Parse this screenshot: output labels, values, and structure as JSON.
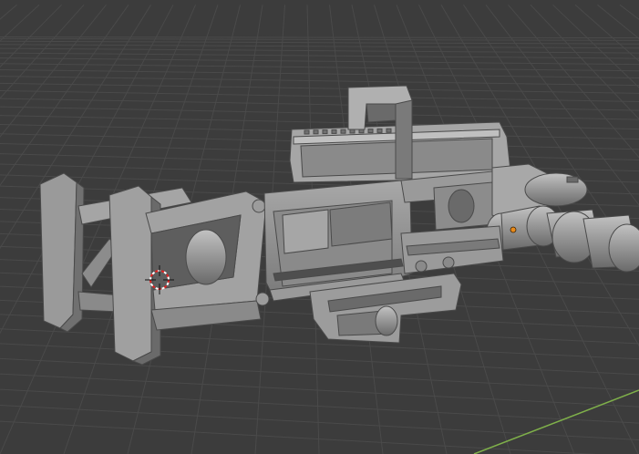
{
  "viewport": {
    "background": "#3c3c3c",
    "grid_color": "#4a4a4a",
    "axis_y_color": "#7fb04a",
    "model_base": "#8f8f8f",
    "model_light": "#b4b4b4",
    "model_dark": "#5c5c5c",
    "cursor_icon": "3d-cursor-icon",
    "origin_icon": "object-origin-icon",
    "origin_color": "#e88a1a",
    "cursor_color_a": "#e02020",
    "cursor_color_b": "#ffffff"
  }
}
